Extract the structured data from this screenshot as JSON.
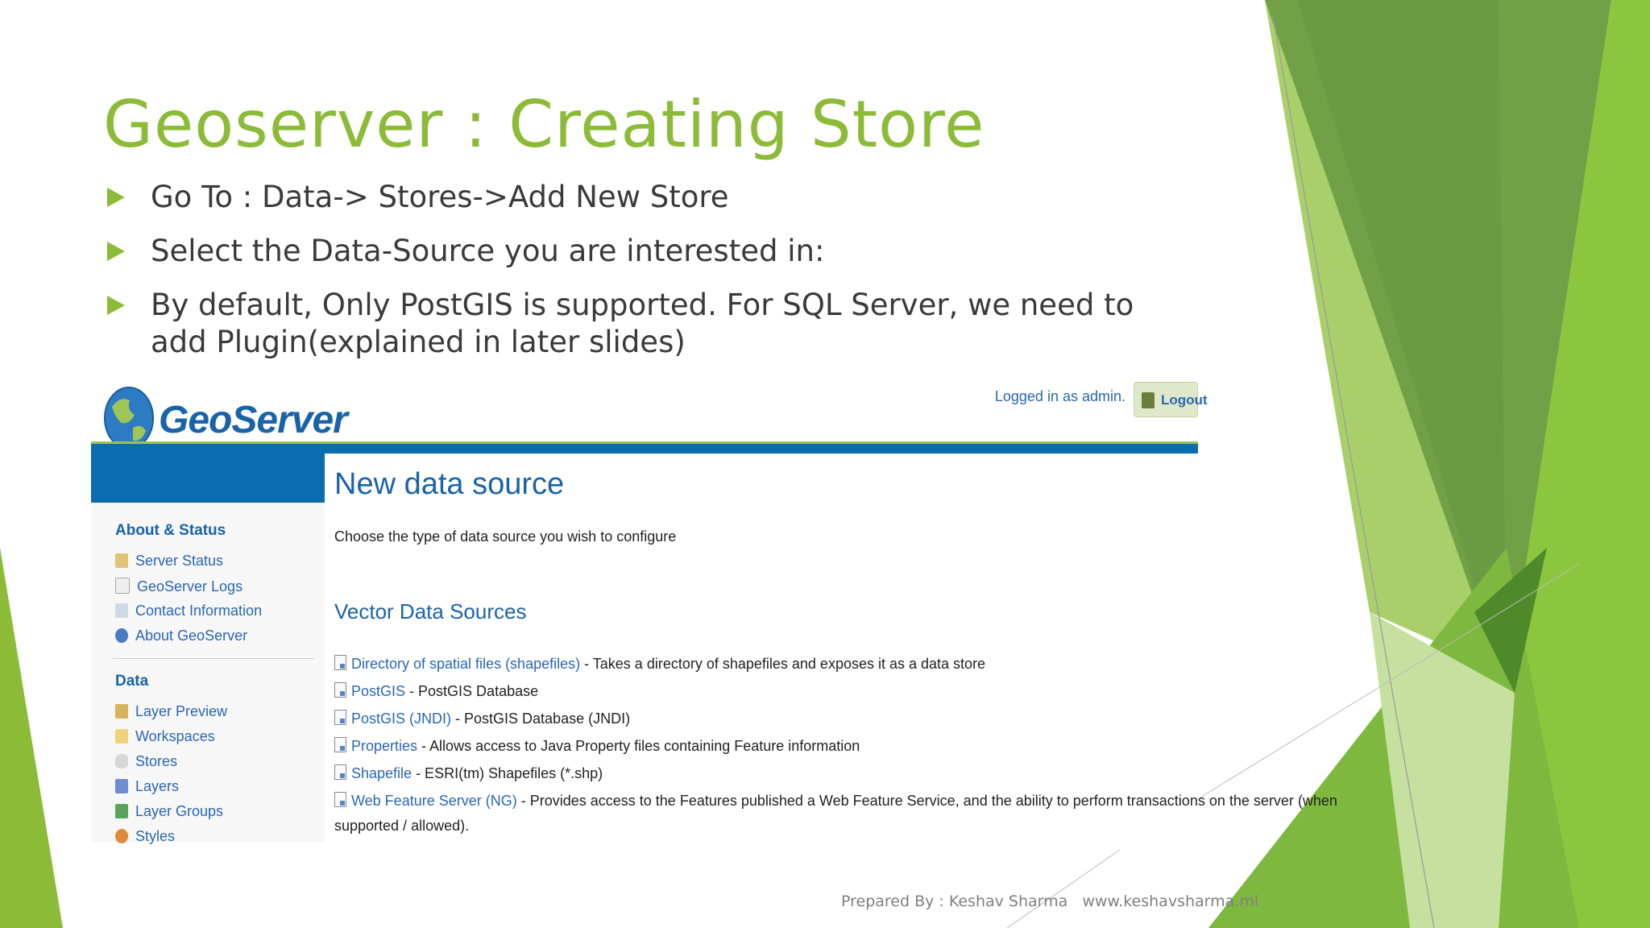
{
  "slide": {
    "title": "Geoserver : Creating Store",
    "bullets": [
      "Go To : Data-> Stores->Add New Store",
      "Select the Data-Source you are interested in:",
      "By default, Only PostGIS is supported. For SQL Server, we need to add Plugin(explained in later slides)"
    ],
    "footer_author": "Prepared By : Keshav Sharma",
    "footer_site": "www.keshavsharma.ml",
    "accent_color": "#8cbb38"
  },
  "geoserver": {
    "logo_text": "GeoServer",
    "logged_in": "Logged in as admin.",
    "logout": "Logout",
    "sidebar": {
      "section1": "About & Status",
      "section1_items": [
        "Server Status",
        "GeoServer Logs",
        "Contact Information",
        "About GeoServer"
      ],
      "section2": "Data",
      "section2_items": [
        "Layer Preview",
        "Workspaces",
        "Stores",
        "Layers",
        "Layer Groups",
        "Styles"
      ]
    },
    "heading": "New data source",
    "description": "Choose the type of data source you wish to configure",
    "vector_heading": "Vector Data Sources",
    "sources": [
      {
        "name": "Directory of spatial files (shapefiles)",
        "desc": " - Takes a directory of shapefiles and exposes it as a data store"
      },
      {
        "name": "PostGIS",
        "desc": " - PostGIS Database"
      },
      {
        "name": "PostGIS (JNDI)",
        "desc": " - PostGIS Database (JNDI)"
      },
      {
        "name": "Properties",
        "desc": " - Allows access to Java Property files containing Feature information"
      },
      {
        "name": "Shapefile",
        "desc": " - ESRI(tm) Shapefiles (*.shp)"
      },
      {
        "name": "Web Feature Server (NG)",
        "desc": " - Provides access to the Features published a Web Feature Service, and the ability to perform transactions on the server (when"
      }
    ],
    "last_line": "supported / allowed)."
  }
}
